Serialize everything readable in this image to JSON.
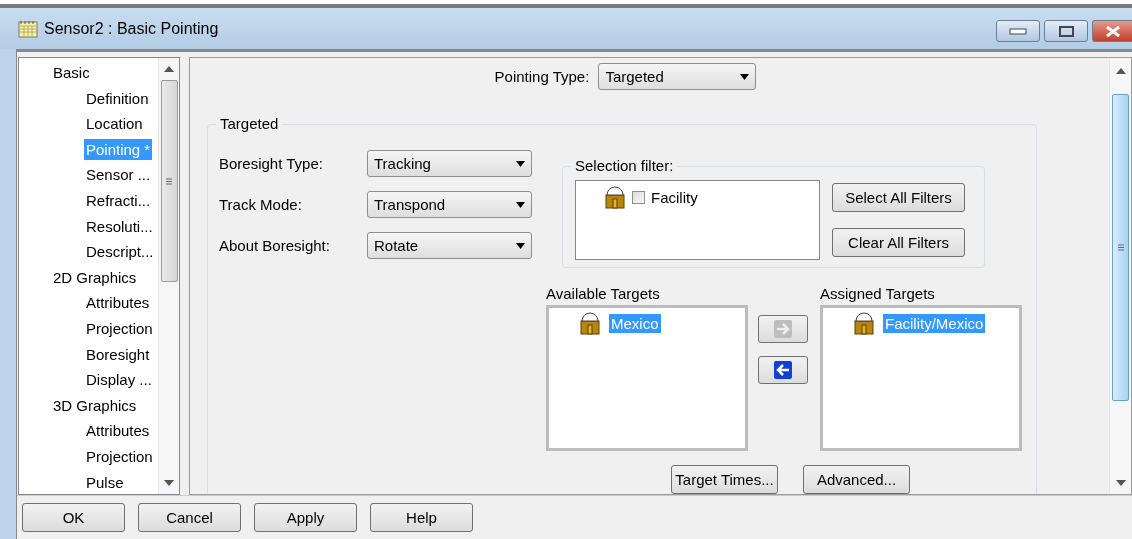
{
  "window": {
    "title": "Sensor2 : Basic Pointing"
  },
  "tree": [
    {
      "label": "Basic",
      "selected": false,
      "children": [
        {
          "label": "Definition",
          "selected": false
        },
        {
          "label": "Location",
          "selected": false
        },
        {
          "label": "Pointing *",
          "selected": true
        },
        {
          "label": "Sensor ...",
          "selected": false
        },
        {
          "label": "Refracti...",
          "selected": false
        },
        {
          "label": "Resoluti...",
          "selected": false
        },
        {
          "label": "Descript...",
          "selected": false
        }
      ]
    },
    {
      "label": "2D Graphics",
      "selected": false,
      "children": [
        {
          "label": "Attributes",
          "selected": false
        },
        {
          "label": "Projection",
          "selected": false
        },
        {
          "label": "Boresight",
          "selected": false
        },
        {
          "label": "Display ...",
          "selected": false
        }
      ]
    },
    {
      "label": "3D Graphics",
      "selected": false,
      "children": [
        {
          "label": "Attributes",
          "selected": false
        },
        {
          "label": "Projection",
          "selected": false
        },
        {
          "label": "Pulse",
          "selected": false
        }
      ]
    }
  ],
  "pointing_type": {
    "label": "Pointing Type:",
    "value": "Targeted"
  },
  "targeted": {
    "title": "Targeted",
    "fields": [
      {
        "label": "Boresight Type:",
        "value": "Tracking"
      },
      {
        "label": "Track Mode:",
        "value": "Transpond"
      },
      {
        "label": "About Boresight:",
        "value": "Rotate"
      }
    ],
    "selection_filter": {
      "title": "Selection filter:",
      "items": [
        {
          "label": "Facility",
          "checked": false
        }
      ],
      "buttons": [
        "Select All Filters",
        "Clear All Filters"
      ]
    },
    "available_targets": {
      "title": "Available Targets",
      "items": [
        {
          "label": "Mexico",
          "selected": true
        }
      ]
    },
    "move_buttons": [
      {
        "kind": "right",
        "disabled": true
      },
      {
        "kind": "left",
        "disabled": false
      }
    ],
    "assigned_targets": {
      "title": "Assigned Targets",
      "items": [
        {
          "label": "Facility/Mexico",
          "selected": true
        }
      ]
    },
    "buttons": [
      "Target Times...",
      "Advanced..."
    ]
  },
  "footer_buttons": [
    "OK",
    "Cancel",
    "Apply",
    "Help"
  ]
}
